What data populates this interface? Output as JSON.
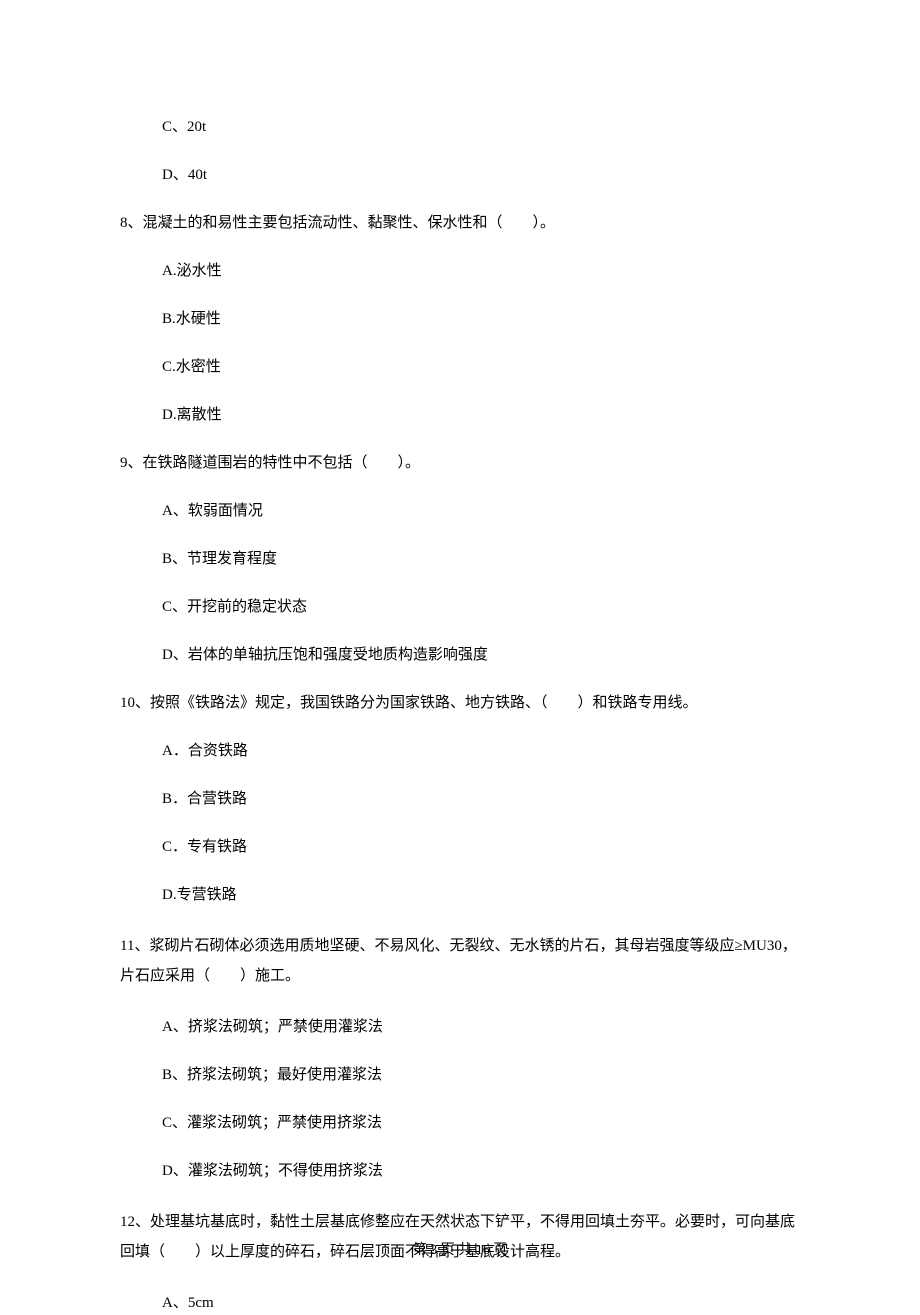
{
  "options_prefix": {
    "c": "C、20t",
    "d": "D、40t"
  },
  "q8": {
    "stem": "8、混凝土的和易性主要包括流动性、黏聚性、保水性和（　　）。",
    "a": "A.泌水性",
    "b": "B.水硬性",
    "c": "C.水密性",
    "d": "D.离散性"
  },
  "q9": {
    "stem": "9、在铁路隧道围岩的特性中不包括（　　）。",
    "a": "A、软弱面情况",
    "b": "B、节理发育程度",
    "c": "C、开挖前的稳定状态",
    "d": "D、岩体的单轴抗压饱和强度受地质构造影响强度"
  },
  "q10": {
    "stem": "10、按照《铁路法》规定，我国铁路分为国家铁路、地方铁路、（　　）和铁路专用线。",
    "a": "A．合资铁路",
    "b": "B．合营铁路",
    "c": "C．专有铁路",
    "d": "D.专营铁路"
  },
  "q11": {
    "stem": "11、浆砌片石砌体必须选用质地坚硬、不易风化、无裂纹、无水锈的片石，其母岩强度等级应≥MU30，片石应采用（　　）施工。",
    "a": "A、挤浆法砌筑；严禁使用灌浆法",
    "b": "B、挤浆法砌筑；最好使用灌浆法",
    "c": "C、灌浆法砌筑；严禁使用挤浆法",
    "d": "D、灌浆法砌筑；不得使用挤浆法"
  },
  "q12": {
    "stem": "12、处理基坑基底时，黏性土层基底修整应在天然状态下铲平，不得用回填土夯平。必要时，可向基底回填（　　）以上厚度的碎石，碎石层顶面不得高于基底设计高程。",
    "a": "A、5cm"
  },
  "footer": "第 3 页 共 16 页"
}
